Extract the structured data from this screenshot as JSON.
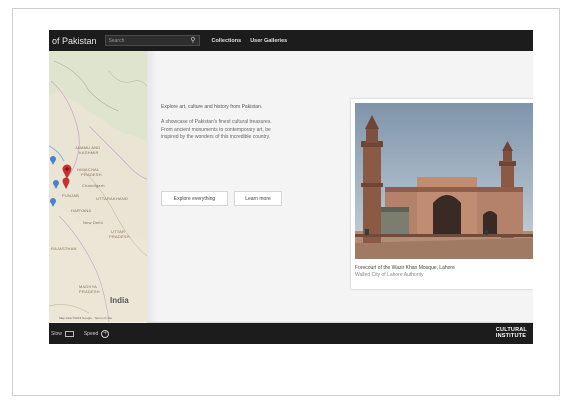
{
  "header": {
    "site_title": "of Pakistan",
    "search_placeholder": "Search",
    "nav": [
      "Collections",
      "User Galleries"
    ]
  },
  "map": {
    "labels": [
      "JAMMU AND",
      "KASHMIR",
      "HIMACHAL",
      "PRADESH",
      "Chandigarh",
      "PUNJAB",
      "UTTARAKHAND",
      "HARYANA",
      "New Delhi",
      "UTTAR",
      "PRADESH",
      "RAJASTHAN",
      "MADHYA",
      "PRADESH"
    ],
    "country": "India",
    "footer": "Map data ©2013 Google · Terms of Use"
  },
  "intro": {
    "lead": "Explore art, culture and history from Pakistan.",
    "desc_lines": [
      "A showcase of Pakistan's finest cultural treasures.",
      "From ancient monuments to contemporary art, be",
      "inspired by the wonders of this incredible country."
    ],
    "buttons": {
      "explore": "Explore everything",
      "learn": "Learn more"
    }
  },
  "featured": {
    "title": "Forecourt of the Wazir Khan Mosque, Lahore",
    "source": "Walled City of Lahore Authority"
  },
  "footer": {
    "view_label": "Slow",
    "speed_label": "Speed",
    "brand_line1": "CULTURAL",
    "brand_line2": "INSTITUTE"
  },
  "colors": {
    "bar": "#1c1c1c",
    "pin_red": "#c8322d",
    "pin_blue": "#4a7fd0",
    "map_bg": "#e9e4d4"
  }
}
